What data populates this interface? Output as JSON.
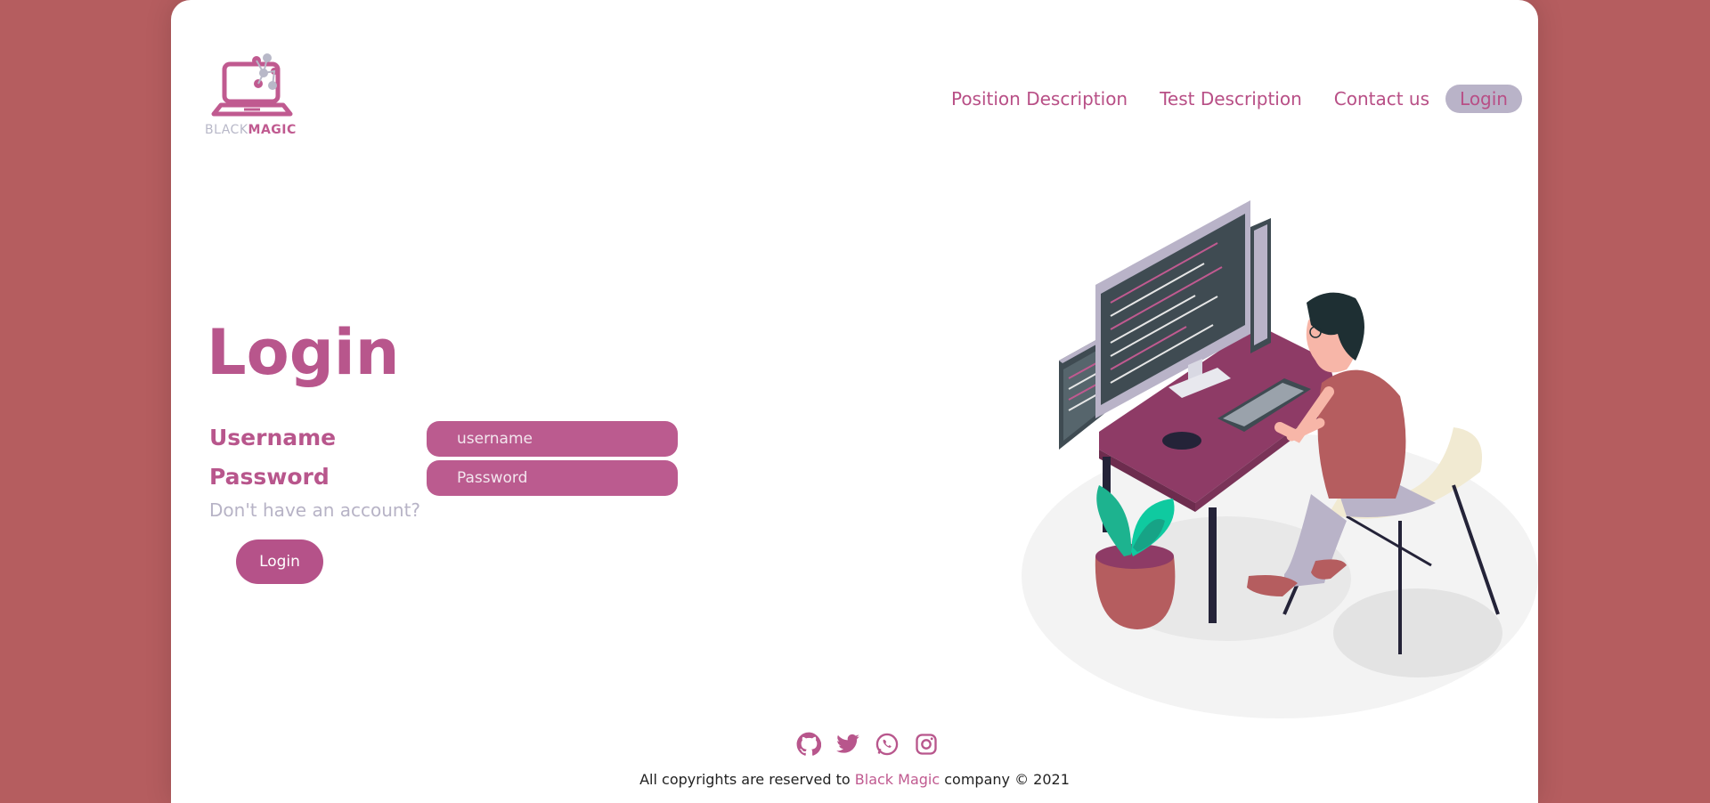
{
  "logo": {
    "text_part1": "BLACK",
    "text_part2": "MAGIC"
  },
  "nav": {
    "items": [
      "Position Description",
      "Test Description",
      "Contact us"
    ],
    "login": "Login"
  },
  "form": {
    "title": "Login",
    "username_label": "Username",
    "password_label": "Password",
    "username_placeholder": "username",
    "password_placeholder": "Password",
    "no_account": "Don't have an account?",
    "submit": "Login"
  },
  "footer": {
    "social_icons": [
      "github-icon",
      "twitter-icon",
      "whatsapp-icon",
      "instagram-icon"
    ],
    "copy_prefix": "All copyrights are reserved to",
    "copy_brand": "Black Magic",
    "copy_suffix": "company © 2021"
  },
  "colors": {
    "background": "#b55d5f",
    "accent": "#b8568c",
    "nav_pill": "#b9b3c8"
  }
}
